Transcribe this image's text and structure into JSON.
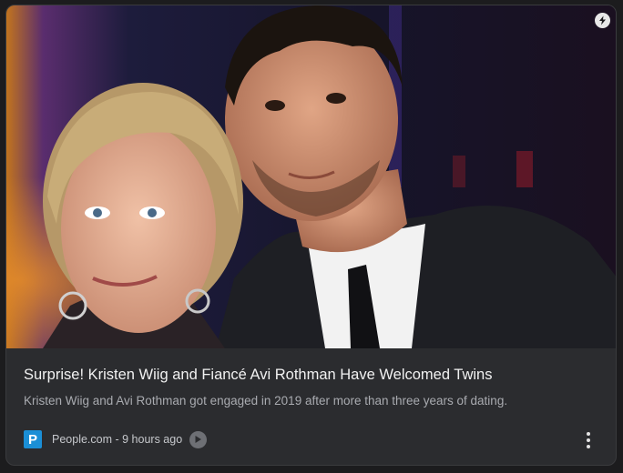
{
  "card": {
    "headline": "Surprise! Kristen Wiig and Fiancé Avi Rothman Have Welcomed Twins",
    "snippet": "Kristen Wiig and Avi Rothman got engaged in 2019 after more than three years of dating.",
    "source": "People.com",
    "separator": " - ",
    "time_ago": "9 hours ago",
    "publisher_logo_letter": "P",
    "publisher_logo_color": "#1b8fd6",
    "hero_image_icon": "photo-of-couple",
    "badge_icon": "lightning-bolt-icon",
    "play_icon": "play-icon",
    "more_icon": "more-vertical-icon"
  }
}
